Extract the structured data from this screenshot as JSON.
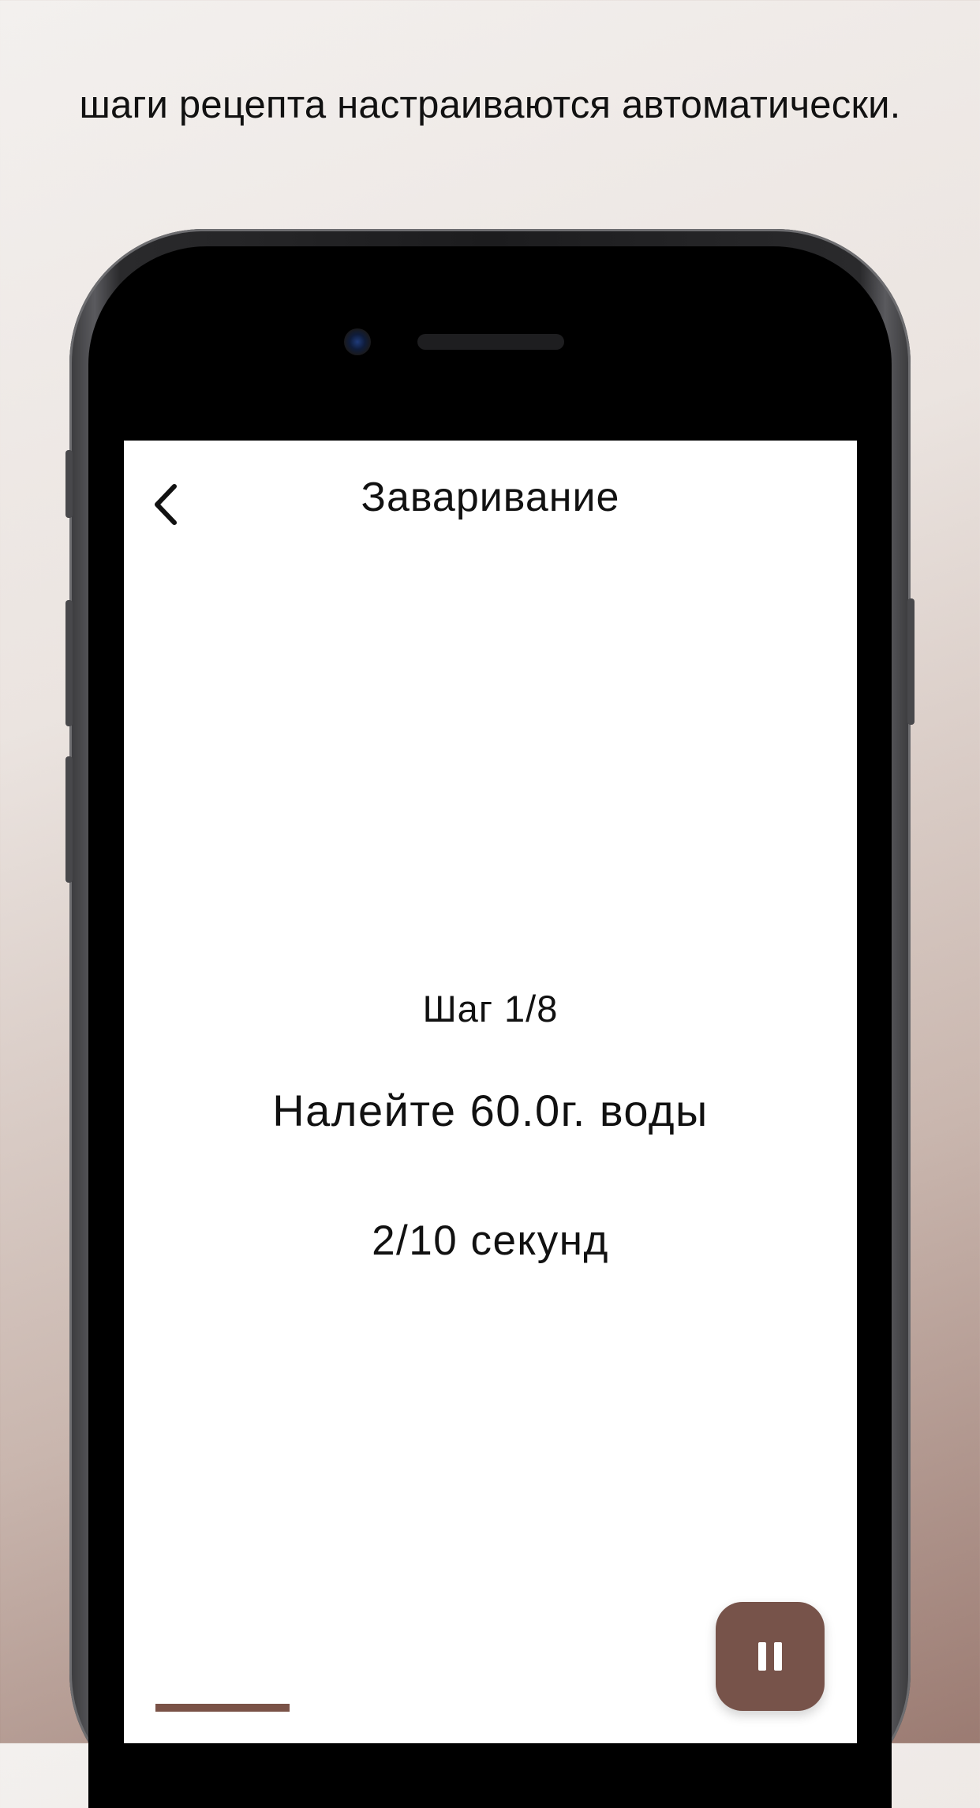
{
  "caption": "шаги рецепта настраиваются автоматически.",
  "screen": {
    "nav": {
      "back_icon": "chevron-left-icon",
      "title": "Заваривание"
    },
    "step_label": "Шаг 1/8",
    "instruction": "Налейте 60.0г. воды",
    "timer": "2/10 секунд",
    "progress": {
      "fraction": 0.125,
      "color": "#7a5247"
    },
    "pause_button": {
      "icon": "pause-icon",
      "color": "#77534a"
    }
  }
}
